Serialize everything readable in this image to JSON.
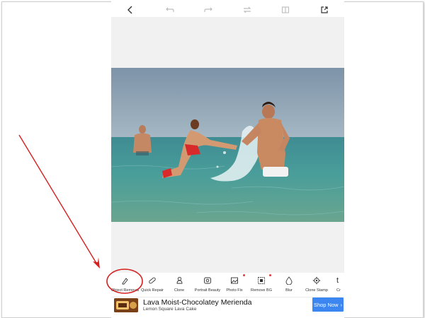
{
  "topbar": {
    "icons": [
      "back-icon",
      "undo-icon",
      "redo-icon",
      "compare-icon",
      "split-view-icon",
      "export-icon"
    ]
  },
  "tools": [
    {
      "label": "Object Removal",
      "icon": "eraser-icon",
      "dot": false
    },
    {
      "label": "Quick Repair",
      "icon": "bandage-icon",
      "dot": false
    },
    {
      "label": "Clone",
      "icon": "clone-stamp-icon",
      "dot": false
    },
    {
      "label": "Portrait Beauty",
      "icon": "portrait-icon",
      "dot": true
    },
    {
      "label": "Photo Fix",
      "icon": "photo-fix-icon",
      "dot": false
    },
    {
      "label": "Remove BG",
      "icon": "remove-bg-icon",
      "dot": true
    },
    {
      "label": "Blur",
      "icon": "blur-drop-icon",
      "dot": false
    },
    {
      "label": "Clone Stamp",
      "icon": "gear-icon",
      "dot": false
    },
    {
      "label": "Cr",
      "icon": "text-icon",
      "dot": false
    }
  ],
  "ad": {
    "title": "Lava Moist-Chocolatey Merienda",
    "subtitle": "Lemon Square Lava Cake",
    "button": "Shop Now"
  },
  "colors": {
    "annotation": "#d62020",
    "button": "#3b86f0",
    "dot": "#e23b3b"
  }
}
